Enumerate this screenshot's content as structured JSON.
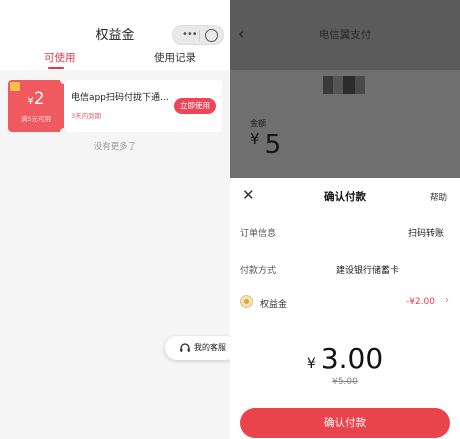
{
  "left": {
    "title": "权益金",
    "capsule": {
      "more": "•••"
    },
    "tabs": [
      {
        "label": "可使用",
        "active": true
      },
      {
        "label": "使用记录",
        "active": false
      }
    ],
    "coupon": {
      "currency": "¥",
      "amount": "2",
      "condition": "满5元可用",
      "name": "电信app扫码付拢下通…",
      "expire": "3天内到期",
      "use_button": "立即使用"
    },
    "no_more": "没有更多了",
    "service": {
      "label": "我的客服",
      "icon": "headset-icon"
    }
  },
  "right": {
    "nav_title": "电信翼支付",
    "amount_label": "金额",
    "currency": "¥",
    "amount": "5",
    "sheet": {
      "close_icon": "close-icon",
      "title": "确认付款",
      "help": "帮助",
      "order_label": "订单信息",
      "order_value": "扫码转账",
      "method_label": "付款方式",
      "method_value": "建设银行储蓄卡",
      "rights_label": "权益金",
      "rights_deduct": "-¥2.00",
      "total_currency": "¥",
      "total": "3.00",
      "original": "¥5.00",
      "confirm": "确认付款"
    }
  },
  "colors": {
    "accent": "#e7374a",
    "coupon": "#ee5a5f",
    "overlay": "#6f6f6f"
  }
}
